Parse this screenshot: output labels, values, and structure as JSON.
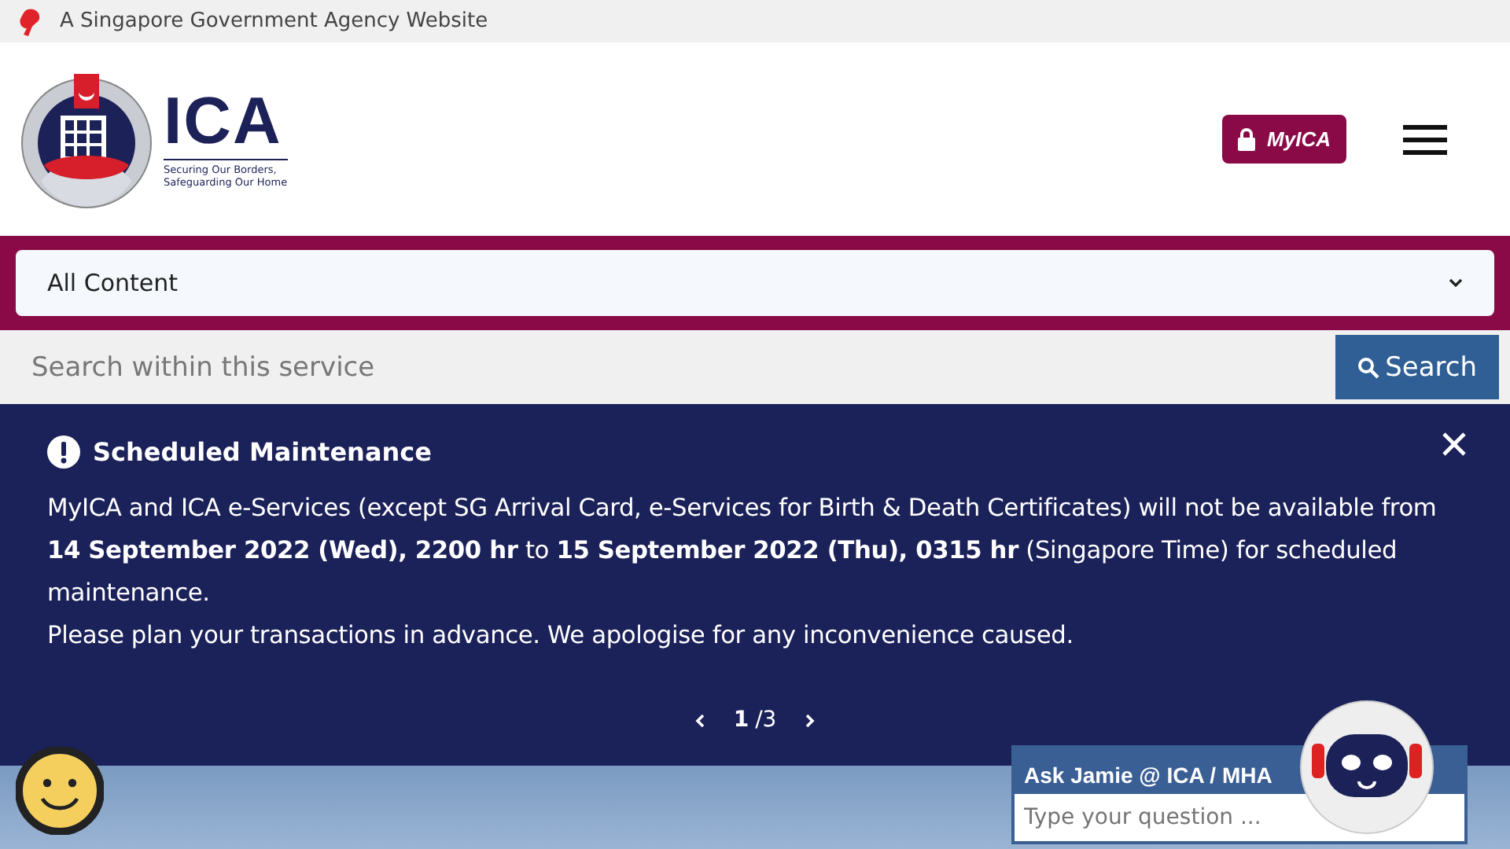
{
  "masthead": {
    "text": "A Singapore Government Agency Website"
  },
  "logo": {
    "name": "ICA",
    "tagline": "Securing Our Borders,\nSafeguarding Our Home"
  },
  "myica_button": {
    "label": "MyICA"
  },
  "content_select": {
    "value": "All Content"
  },
  "search": {
    "placeholder": "Search within this service",
    "button": "Search"
  },
  "notice": {
    "title": "Scheduled Maintenance",
    "paragraphs": [
      "MyICA and ICA e-Services (except SG Arrival Card, e-Services for Birth & Death Certificates) will not be available from **14 September 2022 (Wed), 2200 hr** to **15 September 2022 (Thu), 0315 hr** (Singapore Time) for scheduled maintenance.",
      "Please plan your transactions in advance. We apologise for any inconvenience caused."
    ],
    "current_page": "1",
    "page_total": "/3"
  },
  "chat": {
    "title": "Ask Jamie @ ICA / MHA",
    "placeholder": "Type your question ..."
  }
}
